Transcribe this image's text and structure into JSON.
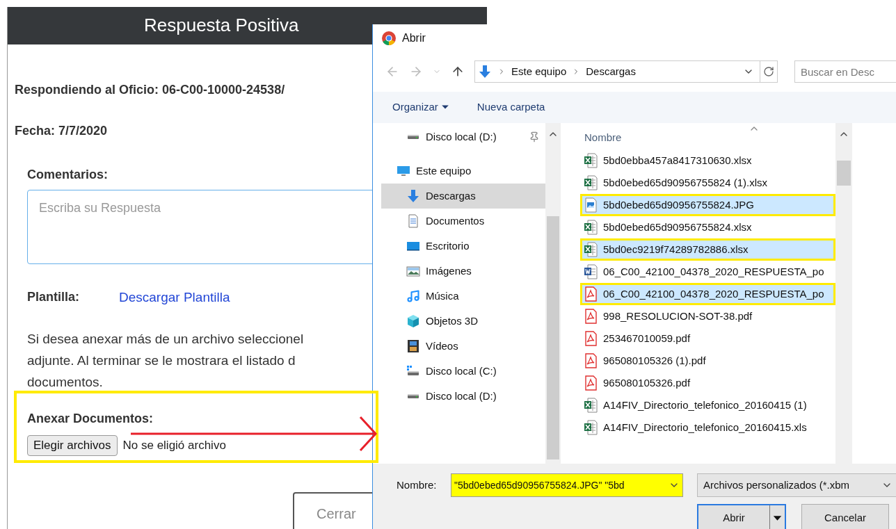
{
  "modal": {
    "title": "Respuesta Positiva",
    "oficio": "Respondiendo al Oficio: 06-C00-10000-24538/",
    "fecha": "Fecha: 7/7/2020",
    "comments_label": "Comentarios:",
    "comments_placeholder": "Escriba su Respuesta",
    "template_label": "Plantilla:",
    "template_link": "Descargar Plantilla",
    "instructions": [
      "Si desea anexar más de un archivo seleccionel",
      "adjunte. Al terminar se le mostrara el listado d",
      "documentos."
    ],
    "attach_label": "Anexar Documentos:",
    "choose_button": "Elegir archivos",
    "no_file": "No se eligió archivo",
    "close_button": "Cerrar"
  },
  "dialog": {
    "title": "Abrir",
    "breadcrumb": [
      "Este equipo",
      "Descargas"
    ],
    "search_placeholder": "Buscar en Desc",
    "organize": "Organizar",
    "new_folder": "Nueva carpeta",
    "nav": [
      {
        "label": "Disco local (D:)",
        "kind": "drive",
        "pinned": true,
        "selected": false
      },
      {
        "label": "Este equipo",
        "kind": "computer",
        "pinned": false,
        "selected": false,
        "children": [
          {
            "label": "Descargas",
            "kind": "download",
            "pinned": false,
            "selected": true
          },
          {
            "label": "Documentos",
            "kind": "documents",
            "pinned": false,
            "selected": false
          },
          {
            "label": "Escritorio",
            "kind": "desktop",
            "pinned": false,
            "selected": false
          },
          {
            "label": "Imágenes",
            "kind": "images",
            "pinned": false,
            "selected": false
          },
          {
            "label": "Música",
            "kind": "music",
            "pinned": false,
            "selected": false
          },
          {
            "label": "Objetos 3D",
            "kind": "objects",
            "pinned": false,
            "selected": false
          },
          {
            "label": "Vídeos",
            "kind": "videos",
            "pinned": false,
            "selected": false
          },
          {
            "label": "Disco local (C:)",
            "kind": "system_drive",
            "pinned": false,
            "selected": false
          },
          {
            "label": "Disco local (D:)",
            "kind": "drive",
            "pinned": false,
            "selected": false
          }
        ]
      }
    ],
    "column": "Nombre",
    "files": [
      {
        "name": "5bd0ebba457a8417310630.xlsx",
        "kind": "excel",
        "selected": false
      },
      {
        "name": "5bd0ebed65d90956755824 (1).xlsx",
        "kind": "excel",
        "selected": false
      },
      {
        "name": "5bd0ebed65d90956755824.JPG",
        "kind": "image",
        "selected": true
      },
      {
        "name": "5bd0ebed65d90956755824.xlsx",
        "kind": "excel",
        "selected": false
      },
      {
        "name": "5bd0ec9219f74289782886.xlsx",
        "kind": "excel",
        "selected": true
      },
      {
        "name": "06_C00_42100_04378_2020_RESPUESTA_po",
        "kind": "word",
        "selected": false
      },
      {
        "name": "06_C00_42100_04378_2020_RESPUESTA_po",
        "kind": "pdf",
        "selected": true
      },
      {
        "name": "998_RESOLUCION-SOT-38.pdf",
        "kind": "pdf",
        "selected": false
      },
      {
        "name": "253467010059.pdf",
        "kind": "pdf",
        "selected": false
      },
      {
        "name": "965080105326 (1).pdf",
        "kind": "pdf",
        "selected": false
      },
      {
        "name": "965080105326.pdf",
        "kind": "pdf",
        "selected": false
      },
      {
        "name": "A14FIV_Directorio_telefonico_20160415 (1)",
        "kind": "excel",
        "selected": false
      },
      {
        "name": "A14FIV_Directorio_telefonico_20160415.xls",
        "kind": "excel",
        "selected": false
      }
    ],
    "filename_label": "Nombre:",
    "filename_value": "\"5bd0ebed65d90956755824.JPG\" \"5bd",
    "filetype": "Archivos personalizados (*.xbm",
    "open_button": "Abrir",
    "cancel_button": "Cancelar"
  }
}
